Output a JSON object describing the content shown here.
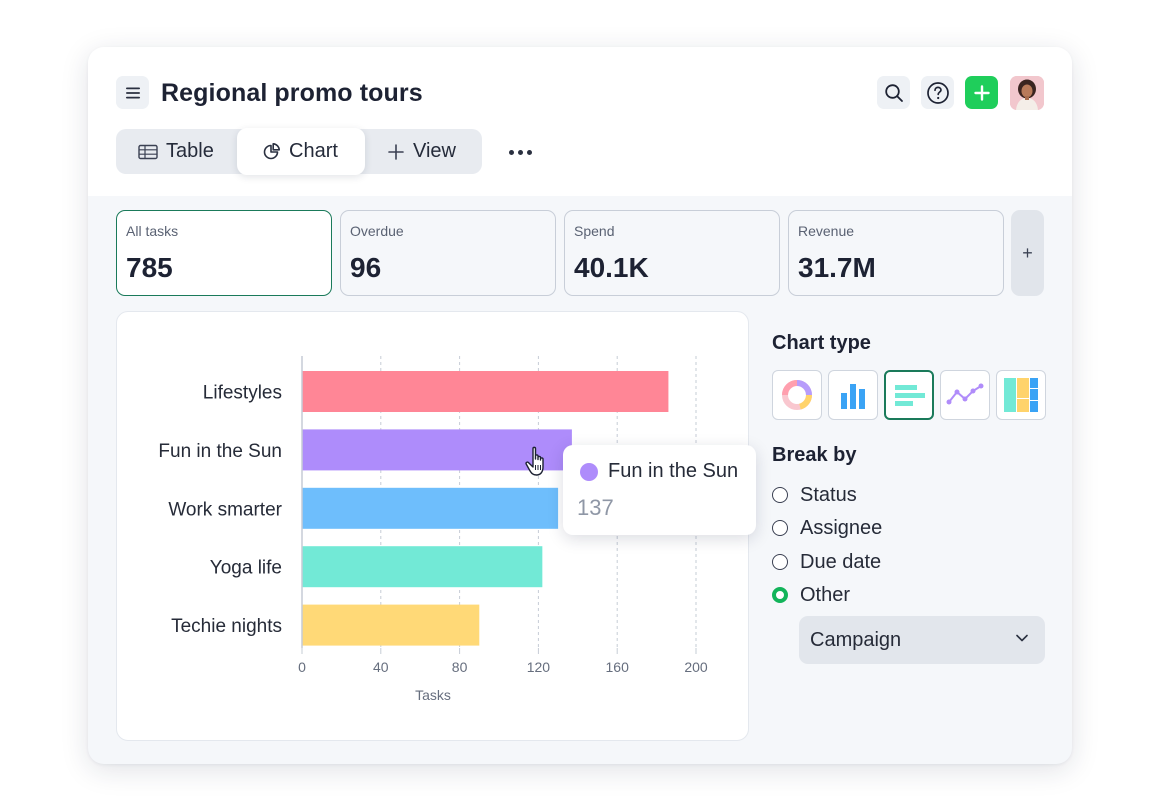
{
  "header": {
    "title": "Regional promo tours",
    "menu_icon": "hamburger-menu-icon",
    "actions": [
      "search-icon",
      "help-icon",
      "plus-icon",
      "user-avatar"
    ]
  },
  "view_tabs": [
    {
      "label": "Table",
      "icon": "table-icon"
    },
    {
      "label": "Chart",
      "icon": "pie-chart-icon",
      "active": true
    },
    {
      "label": "View",
      "icon": "plus-icon"
    }
  ],
  "stats": [
    {
      "label": "All tasks",
      "value": "785",
      "active": true
    },
    {
      "label": "Overdue",
      "value": "96"
    },
    {
      "label": "Spend",
      "value": "40.1K"
    },
    {
      "label": "Revenue",
      "value": "31.7M"
    }
  ],
  "stats_add_label": "+",
  "chart_data": {
    "type": "bar",
    "orientation": "horizontal",
    "categories": [
      "Lifestyles",
      "Fun in the Sun",
      "Work smarter",
      "Yoga life",
      "Techie nights"
    ],
    "values": [
      186,
      137,
      130,
      122,
      90
    ],
    "colors": [
      "#ff8696",
      "#ae8cfb",
      "#6ebefc",
      "#72e9d6",
      "#ffd977"
    ],
    "xlabel": "Tasks",
    "xlim": [
      0,
      210
    ],
    "xticks": [
      0,
      40,
      80,
      120,
      160,
      200
    ],
    "grid": "vertical dashed"
  },
  "tooltip": {
    "name": "Fun in the Sun",
    "value": "137",
    "color": "#ae8cfb"
  },
  "side_panel": {
    "chart_type_title": "Chart type",
    "chart_types": [
      "donut-chart-icon",
      "column-chart-icon",
      "bar-chart-icon",
      "line-chart-icon",
      "treemap-icon"
    ],
    "selected_chart_type": "bar-chart-icon",
    "break_by_title": "Break by",
    "break_by_options": [
      "Status",
      "Assignee",
      "Due date",
      "Other"
    ],
    "break_by_selected": "Other",
    "select_value": "Campaign"
  },
  "colors": {
    "accent": "#1a7a5a",
    "add_button": "#1fce5b",
    "radio_checked": "#12b45a"
  }
}
